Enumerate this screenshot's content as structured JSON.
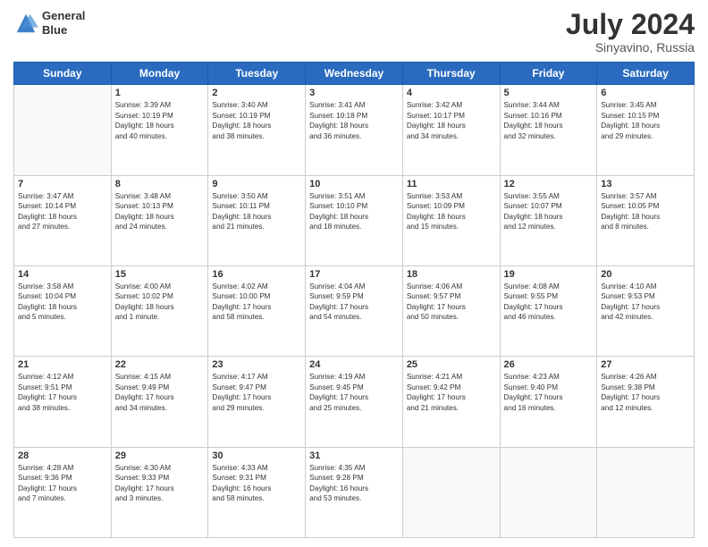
{
  "header": {
    "logo_line1": "General",
    "logo_line2": "Blue",
    "month": "July 2024",
    "location": "Sinyavino, Russia"
  },
  "days_of_week": [
    "Sunday",
    "Monday",
    "Tuesday",
    "Wednesday",
    "Thursday",
    "Friday",
    "Saturday"
  ],
  "weeks": [
    [
      {
        "day": "",
        "text": ""
      },
      {
        "day": "1",
        "text": "Sunrise: 3:39 AM\nSunset: 10:19 PM\nDaylight: 18 hours\nand 40 minutes."
      },
      {
        "day": "2",
        "text": "Sunrise: 3:40 AM\nSunset: 10:19 PM\nDaylight: 18 hours\nand 38 minutes."
      },
      {
        "day": "3",
        "text": "Sunrise: 3:41 AM\nSunset: 10:18 PM\nDaylight: 18 hours\nand 36 minutes."
      },
      {
        "day": "4",
        "text": "Sunrise: 3:42 AM\nSunset: 10:17 PM\nDaylight: 18 hours\nand 34 minutes."
      },
      {
        "day": "5",
        "text": "Sunrise: 3:44 AM\nSunset: 10:16 PM\nDaylight: 18 hours\nand 32 minutes."
      },
      {
        "day": "6",
        "text": "Sunrise: 3:45 AM\nSunset: 10:15 PM\nDaylight: 18 hours\nand 29 minutes."
      }
    ],
    [
      {
        "day": "7",
        "text": "Sunrise: 3:47 AM\nSunset: 10:14 PM\nDaylight: 18 hours\nand 27 minutes."
      },
      {
        "day": "8",
        "text": "Sunrise: 3:48 AM\nSunset: 10:13 PM\nDaylight: 18 hours\nand 24 minutes."
      },
      {
        "day": "9",
        "text": "Sunrise: 3:50 AM\nSunset: 10:11 PM\nDaylight: 18 hours\nand 21 minutes."
      },
      {
        "day": "10",
        "text": "Sunrise: 3:51 AM\nSunset: 10:10 PM\nDaylight: 18 hours\nand 18 minutes."
      },
      {
        "day": "11",
        "text": "Sunrise: 3:53 AM\nSunset: 10:09 PM\nDaylight: 18 hours\nand 15 minutes."
      },
      {
        "day": "12",
        "text": "Sunrise: 3:55 AM\nSunset: 10:07 PM\nDaylight: 18 hours\nand 12 minutes."
      },
      {
        "day": "13",
        "text": "Sunrise: 3:57 AM\nSunset: 10:05 PM\nDaylight: 18 hours\nand 8 minutes."
      }
    ],
    [
      {
        "day": "14",
        "text": "Sunrise: 3:58 AM\nSunset: 10:04 PM\nDaylight: 18 hours\nand 5 minutes."
      },
      {
        "day": "15",
        "text": "Sunrise: 4:00 AM\nSunset: 10:02 PM\nDaylight: 18 hours\nand 1 minute."
      },
      {
        "day": "16",
        "text": "Sunrise: 4:02 AM\nSunset: 10:00 PM\nDaylight: 17 hours\nand 58 minutes."
      },
      {
        "day": "17",
        "text": "Sunrise: 4:04 AM\nSunset: 9:59 PM\nDaylight: 17 hours\nand 54 minutes."
      },
      {
        "day": "18",
        "text": "Sunrise: 4:06 AM\nSunset: 9:57 PM\nDaylight: 17 hours\nand 50 minutes."
      },
      {
        "day": "19",
        "text": "Sunrise: 4:08 AM\nSunset: 9:55 PM\nDaylight: 17 hours\nand 46 minutes."
      },
      {
        "day": "20",
        "text": "Sunrise: 4:10 AM\nSunset: 9:53 PM\nDaylight: 17 hours\nand 42 minutes."
      }
    ],
    [
      {
        "day": "21",
        "text": "Sunrise: 4:12 AM\nSunset: 9:51 PM\nDaylight: 17 hours\nand 38 minutes."
      },
      {
        "day": "22",
        "text": "Sunrise: 4:15 AM\nSunset: 9:49 PM\nDaylight: 17 hours\nand 34 minutes."
      },
      {
        "day": "23",
        "text": "Sunrise: 4:17 AM\nSunset: 9:47 PM\nDaylight: 17 hours\nand 29 minutes."
      },
      {
        "day": "24",
        "text": "Sunrise: 4:19 AM\nSunset: 9:45 PM\nDaylight: 17 hours\nand 25 minutes."
      },
      {
        "day": "25",
        "text": "Sunrise: 4:21 AM\nSunset: 9:42 PM\nDaylight: 17 hours\nand 21 minutes."
      },
      {
        "day": "26",
        "text": "Sunrise: 4:23 AM\nSunset: 9:40 PM\nDaylight: 17 hours\nand 16 minutes."
      },
      {
        "day": "27",
        "text": "Sunrise: 4:26 AM\nSunset: 9:38 PM\nDaylight: 17 hours\nand 12 minutes."
      }
    ],
    [
      {
        "day": "28",
        "text": "Sunrise: 4:28 AM\nSunset: 9:36 PM\nDaylight: 17 hours\nand 7 minutes."
      },
      {
        "day": "29",
        "text": "Sunrise: 4:30 AM\nSunset: 9:33 PM\nDaylight: 17 hours\nand 3 minutes."
      },
      {
        "day": "30",
        "text": "Sunrise: 4:33 AM\nSunset: 9:31 PM\nDaylight: 16 hours\nand 58 minutes."
      },
      {
        "day": "31",
        "text": "Sunrise: 4:35 AM\nSunset: 9:28 PM\nDaylight: 16 hours\nand 53 minutes."
      },
      {
        "day": "",
        "text": ""
      },
      {
        "day": "",
        "text": ""
      },
      {
        "day": "",
        "text": ""
      }
    ]
  ]
}
